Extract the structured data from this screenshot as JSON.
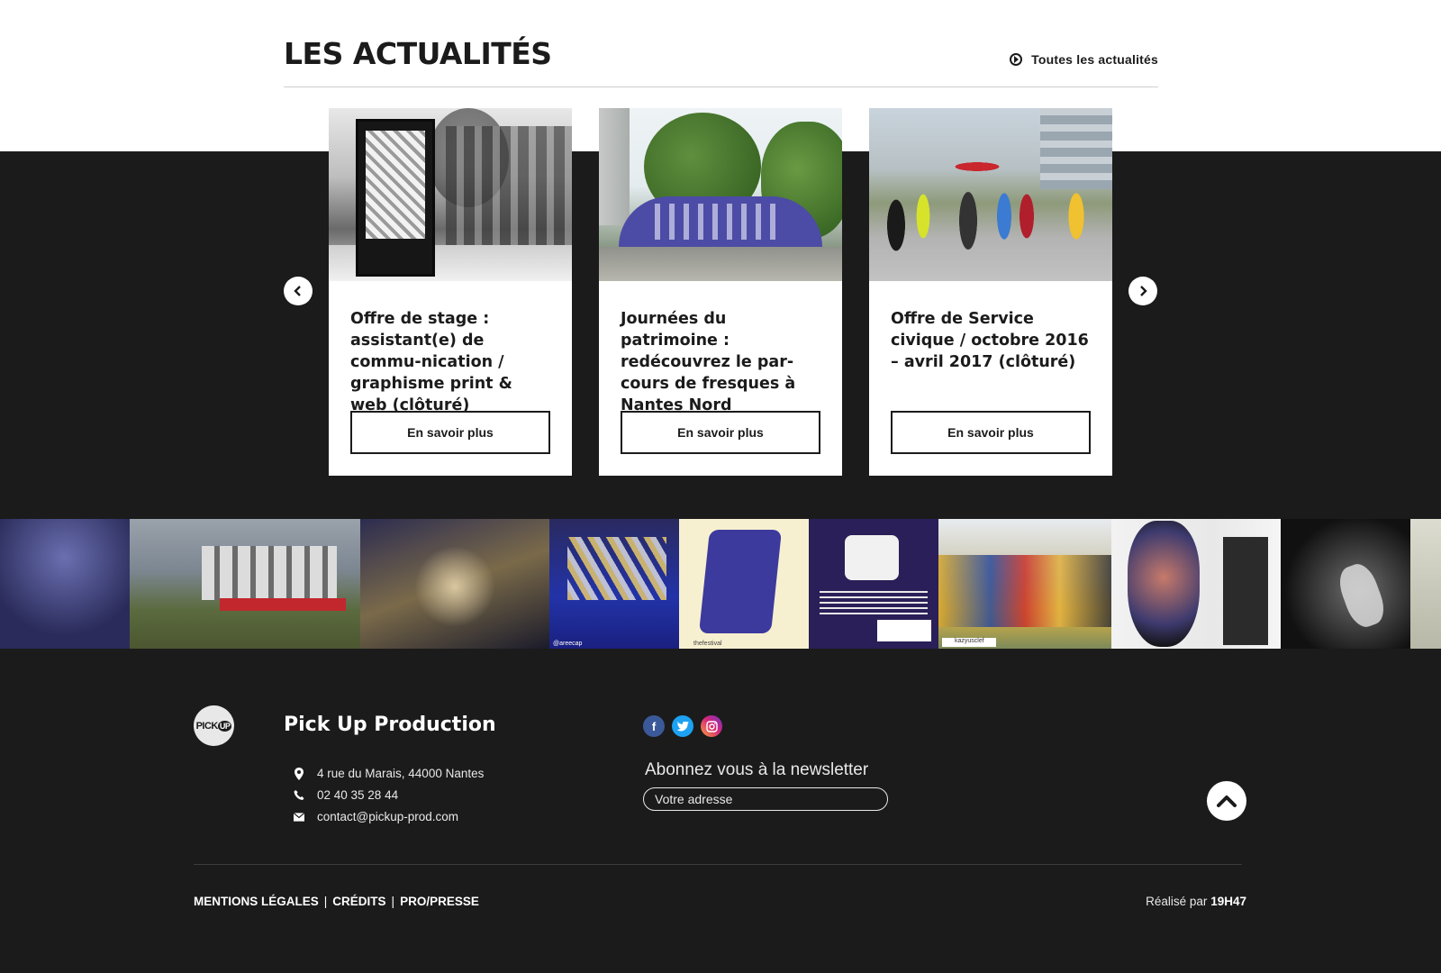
{
  "news": {
    "title": "LES ACTUALITÉS",
    "all_link": "Toutes les actualités",
    "cards": [
      {
        "title": "Offre de stage : assistant(e) de commu-nication / graphisme print & web (clôturé)",
        "button": "En savoir plus"
      },
      {
        "title": "Journées du patrimoine : redécouvrez le par-cours de fresques à Nantes Nord",
        "button": "En savoir plus"
      },
      {
        "title": "Offre de Service civique / octobre 2016 – avril 2017 (clôturé)",
        "button": "En savoir plus"
      }
    ],
    "prev_icon": "chevron-left-icon",
    "next_icon": "chevron-right-icon"
  },
  "instagram": {
    "tiles": [
      {
        "caption": ""
      },
      {
        "caption": ""
      },
      {
        "caption": ""
      },
      {
        "caption": "@areecap"
      },
      {
        "caption": "thefestival"
      },
      {
        "caption": ""
      },
      {
        "caption": "kazyusclef"
      },
      {
        "caption": ""
      },
      {
        "caption": ""
      },
      {
        "caption": ""
      }
    ]
  },
  "footer": {
    "org_name": "Pick Up Production",
    "logo_text": "PICK",
    "logo_up": "UP",
    "address": "4 rue du Marais, 44000 Nantes",
    "phone": "02 40 35 28 44",
    "email": "contact@pickup-prod.com",
    "newsletter_label": "Abonnez vous à la newsletter",
    "newsletter_placeholder": "Votre adresse",
    "legal_links": [
      "MENTIONS LÉGALES",
      "CRÉDITS",
      "PRO/PRESSE"
    ],
    "separator": "|",
    "credit_prefix": "Réalisé par",
    "credit_name": "19H47"
  },
  "colors": {
    "background": "#1b1b1b",
    "card": "#ffffff",
    "facebook": "#3b5998",
    "twitter": "#1da1f2"
  }
}
